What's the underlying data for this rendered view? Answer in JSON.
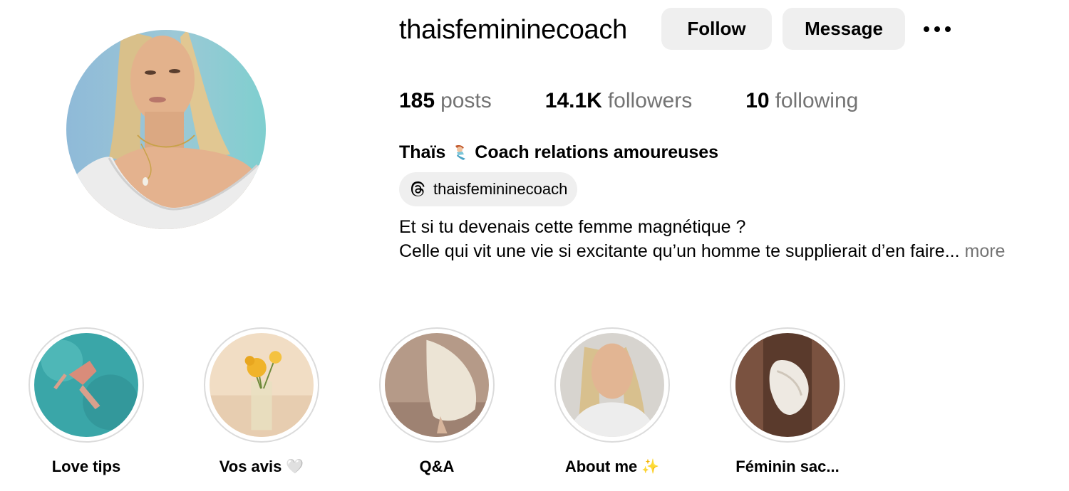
{
  "profile": {
    "username": "thaisfemininecoach",
    "actions": {
      "follow_label": "Follow",
      "message_label": "Message",
      "more_icon": "more-horizontal-icon"
    },
    "stats": [
      {
        "value": "185",
        "label": "posts"
      },
      {
        "value": "14.1K",
        "label": "followers"
      },
      {
        "value": "10",
        "label": "following"
      }
    ],
    "name_part1": "Thaïs",
    "name_emoji_icon": "mermaid-emoji-icon",
    "name_part2": "Coach relations amoureuses",
    "threads": {
      "icon": "threads-icon",
      "handle": "thaisfemininecoach"
    },
    "bio": {
      "line1": "Et si tu devenais cette femme magnétique ?",
      "line2": "Celle qui vit une vie si excitante qu’un homme te supplierait d’en faire...",
      "more_label": "more"
    }
  },
  "highlights": [
    {
      "label": "Love tips",
      "glyph": ""
    },
    {
      "label": "Vos avis",
      "glyph": "🤍"
    },
    {
      "label": "Q&A",
      "glyph": ""
    },
    {
      "label": "About me",
      "glyph": "✨"
    },
    {
      "label": "Féminin sac...",
      "glyph": ""
    }
  ],
  "colors": {
    "button_bg": "#efefef",
    "secondary_text": "#737373",
    "ring": "#dbdbdb"
  }
}
